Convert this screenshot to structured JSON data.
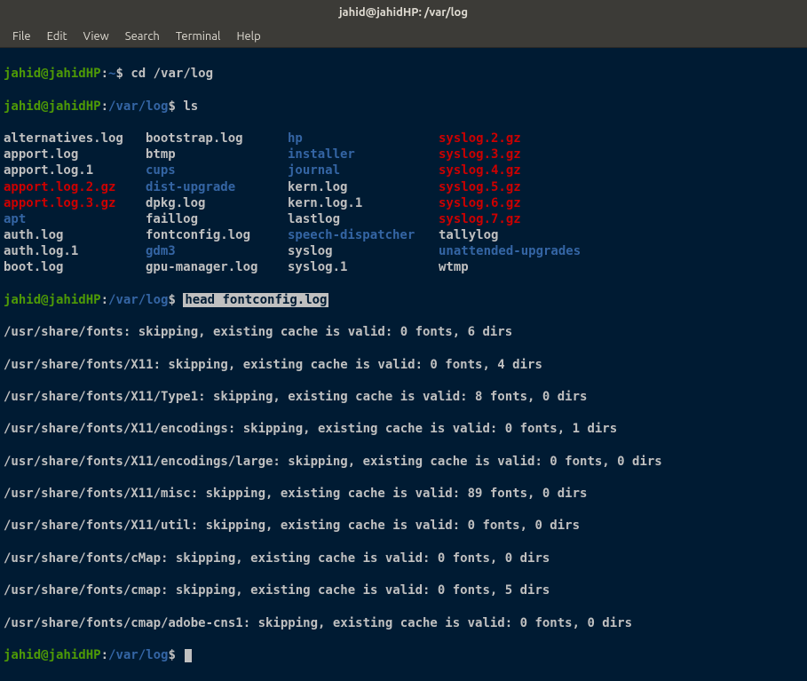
{
  "window": {
    "title": "jahid@jahidHP: /var/log"
  },
  "menu": {
    "file": "File",
    "edit": "Edit",
    "view": "View",
    "search": "Search",
    "terminal": "Terminal",
    "help": "Help"
  },
  "prompts": {
    "user": "jahid@jahidHP",
    "home": "~",
    "path": "/var/log",
    "sign": "$"
  },
  "commands": {
    "cd": "cd /var/log",
    "ls": "ls",
    "head": "head fontconfig.log"
  },
  "listing": {
    "r0": {
      "c0": "alternatives.log",
      "c1": "bootstrap.log",
      "c2": "hp",
      "c3": "syslog.2.gz"
    },
    "r1": {
      "c0": "apport.log",
      "c1": "btmp",
      "c2": "installer",
      "c3": "syslog.3.gz"
    },
    "r2": {
      "c0": "apport.log.1",
      "c1": "cups",
      "c2": "journal",
      "c3": "syslog.4.gz"
    },
    "r3": {
      "c0": "apport.log.2.gz",
      "c1": "dist-upgrade",
      "c2": "kern.log",
      "c3": "syslog.5.gz"
    },
    "r4": {
      "c0": "apport.log.3.gz",
      "c1": "dpkg.log",
      "c2": "kern.log.1",
      "c3": "syslog.6.gz"
    },
    "r5": {
      "c0": "apt",
      "c1": "faillog",
      "c2": "lastlog",
      "c3": "syslog.7.gz"
    },
    "r6": {
      "c0": "auth.log",
      "c1": "fontconfig.log",
      "c2": "speech-dispatcher",
      "c3": "tallylog"
    },
    "r7": {
      "c0": "auth.log.1",
      "c1": "gdm3",
      "c2": "syslog",
      "c3": "unattended-upgrades"
    },
    "r8": {
      "c0": "boot.log",
      "c1": "gpu-manager.log",
      "c2": "syslog.1",
      "c3": "wtmp"
    }
  },
  "output": {
    "l0": "/usr/share/fonts: skipping, existing cache is valid: 0 fonts, 6 dirs",
    "l1": "/usr/share/fonts/X11: skipping, existing cache is valid: 0 fonts, 4 dirs",
    "l2": "/usr/share/fonts/X11/Type1: skipping, existing cache is valid: 8 fonts, 0 dirs",
    "l3": "/usr/share/fonts/X11/encodings: skipping, existing cache is valid: 0 fonts, 1 dirs",
    "l4": "/usr/share/fonts/X11/encodings/large: skipping, existing cache is valid: 0 fonts, 0 dirs",
    "l5": "/usr/share/fonts/X11/misc: skipping, existing cache is valid: 89 fonts, 0 dirs",
    "l6": "/usr/share/fonts/X11/util: skipping, existing cache is valid: 0 fonts, 0 dirs",
    "l7": "/usr/share/fonts/cMap: skipping, existing cache is valid: 0 fonts, 0 dirs",
    "l8": "/usr/share/fonts/cmap: skipping, existing cache is valid: 0 fonts, 5 dirs",
    "l9": "/usr/share/fonts/cmap/adobe-cns1: skipping, existing cache is valid: 0 fonts, 0 dirs"
  }
}
